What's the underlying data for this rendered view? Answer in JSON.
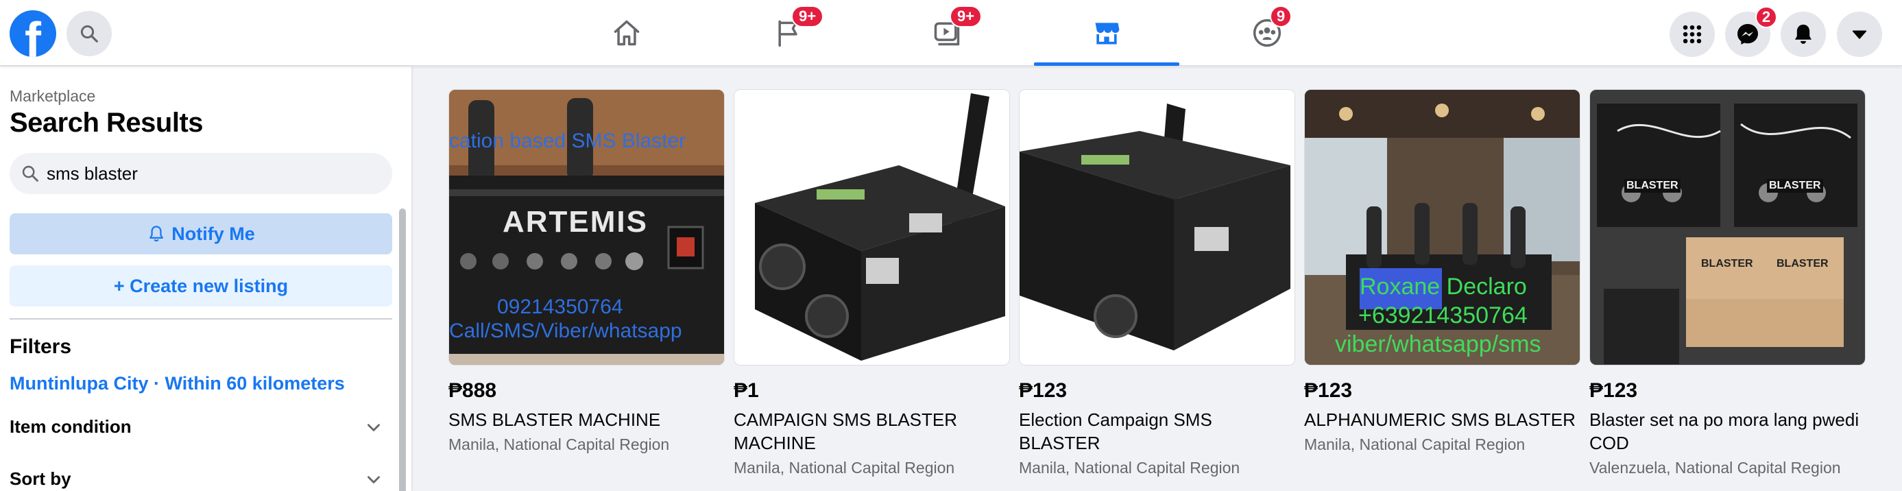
{
  "nav": {
    "tabs": [
      {
        "name": "home",
        "badge": ""
      },
      {
        "name": "pages",
        "badge": "9+"
      },
      {
        "name": "watch",
        "badge": "9+"
      },
      {
        "name": "marketplace",
        "badge": ""
      },
      {
        "name": "groups",
        "badge": "9"
      }
    ],
    "messenger_badge": "2",
    "accent": "#1877f2",
    "badge_color": "#e41e3f"
  },
  "sidebar": {
    "breadcrumb": "Marketplace",
    "title": "Search Results",
    "search_value": "sms blaster",
    "notify_label": "Notify Me",
    "create_label": "+ Create new listing",
    "filters_heading": "Filters",
    "location": "Muntinlupa City · Within 60 kilometers",
    "item_condition": "Item condition",
    "sort_by": "Sort by"
  },
  "listings": [
    {
      "price": "₱888",
      "title": "SMS BLASTER MACHINE",
      "location": "Manila, National Capital Region",
      "overlay_top": "cation based SMS Blaster",
      "brand": "ARTEMIS",
      "overlay_phone": "09214350764",
      "overlay_contact": "Call/SMS/Viber/whatsapp"
    },
    {
      "price": "₱1",
      "title": "CAMPAIGN SMS BLASTER MACHINE",
      "location": "Manila, National Capital Region"
    },
    {
      "price": "₱123",
      "title": "Election Campaign SMS BLASTER",
      "location": "Manila, National Capital Region"
    },
    {
      "price": "₱123",
      "title": "ALPHANUMERIC SMS BLASTER",
      "location": "Manila, National Capital Region",
      "overlay_name": "Roxane Declaro",
      "overlay_phone": "+639214350764",
      "overlay_contact": "viber/whatsapp/sms"
    },
    {
      "price": "₱123",
      "title": "Blaster set na po mora lang pwedi COD",
      "location": "Valenzuela, National Capital Region",
      "box_label": "BLASTER"
    }
  ]
}
